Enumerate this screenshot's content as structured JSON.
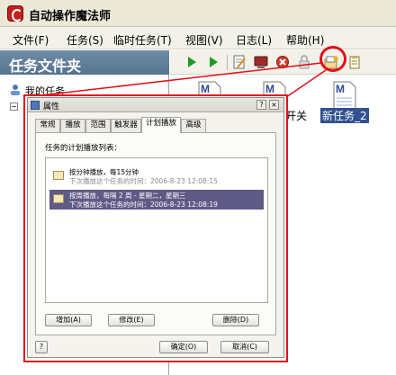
{
  "app": {
    "title": "自动操作魔法师"
  },
  "menu": [
    "文件(F)",
    "任务(S)",
    "临时任务(T)",
    "视图(V)",
    "日志(L)",
    "帮助(H)"
  ],
  "left_pane": {
    "header": "任务文件夹",
    "root_label": "我的任务",
    "expand_glyph": "−"
  },
  "right_pane": {
    "files": [
      {
        "label": "开关",
        "selected": false
      },
      {
        "label": "新任务_2",
        "selected": true
      }
    ]
  },
  "dialog": {
    "title": "属性",
    "controls": {
      "help": "?",
      "close": "×"
    },
    "tabs": [
      {
        "label": "常规",
        "active": false
      },
      {
        "label": "播放",
        "active": false
      },
      {
        "label": "范围",
        "active": false
      },
      {
        "label": "触发器",
        "active": false
      },
      {
        "label": "计划播放",
        "active": true
      },
      {
        "label": "高级",
        "active": false
      }
    ],
    "list_label": "任务的计划播放列表：",
    "schedules": [
      {
        "title": "按分钟播放，每15分钟",
        "next": "下次播放这个任务的时间：2006-8-23 12:08:15",
        "selected": false
      },
      {
        "title": "按周播放，每隔 2 周 - 星期二，星期三",
        "next": "下次播放这个任务的时间：2006-8-23 12:08:19",
        "selected": true
      }
    ],
    "buttons": {
      "add": "增加(A)",
      "edit": "修改(E)",
      "delete": "删除(D)"
    },
    "footer": {
      "help": "?",
      "ok": "确定(O)",
      "cancel": "取消(C)"
    }
  },
  "colors": {
    "highlight": "#e0101c",
    "selection": "#5f5a86",
    "pane_header": "#56738f"
  }
}
